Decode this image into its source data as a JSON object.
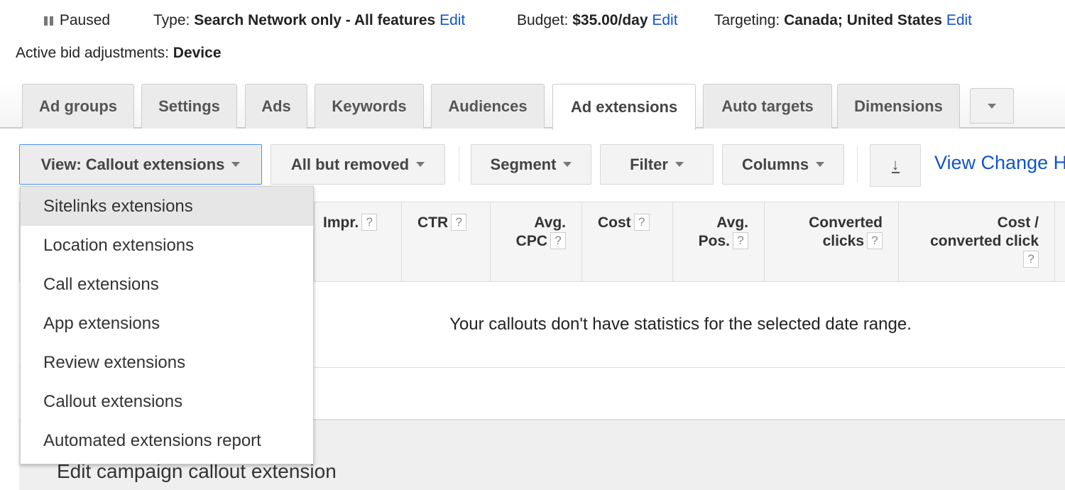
{
  "summary": {
    "status": "Paused",
    "type_label": "Type:",
    "type_value": "Search Network only - All features",
    "budget_label": "Budget:",
    "budget_value": "$35.00/day",
    "targeting_label": "Targeting:",
    "targeting_value": "Canada; United States",
    "edit": "Edit",
    "bid_label": "Active bid adjustments:",
    "bid_value": "Device"
  },
  "tabs": [
    "Ad groups",
    "Settings",
    "Ads",
    "Keywords",
    "Audiences",
    "Ad extensions",
    "Auto targets",
    "Dimensions"
  ],
  "active_tab": "Ad extensions",
  "toolbar": {
    "view": "View: Callout extensions",
    "status_filter": "All but removed",
    "segment": "Segment",
    "filter": "Filter",
    "columns": "Columns",
    "view_change_history": "View Change H"
  },
  "columns": [
    {
      "l1": "Impr.",
      "l2": ""
    },
    {
      "l1": "CTR",
      "l2": ""
    },
    {
      "l1": "Avg.",
      "l2": "CPC"
    },
    {
      "l1": "Cost",
      "l2": ""
    },
    {
      "l1": "Avg.",
      "l2": "Pos."
    },
    {
      "l1": "Converted",
      "l2": "clicks"
    },
    {
      "l1": "Cost /",
      "l2": "converted click"
    }
  ],
  "help": "?",
  "empty_message": "Your callouts don't have statistics for the selected date range.",
  "section_title": "Edit campaign callout extension",
  "view_menu": [
    "Sitelinks extensions",
    "Location extensions",
    "Call extensions",
    "App extensions",
    "Review extensions",
    "Callout extensions",
    "Automated extensions report"
  ],
  "colors": {
    "link": "#1155cc",
    "focus": "#4d90fe"
  }
}
